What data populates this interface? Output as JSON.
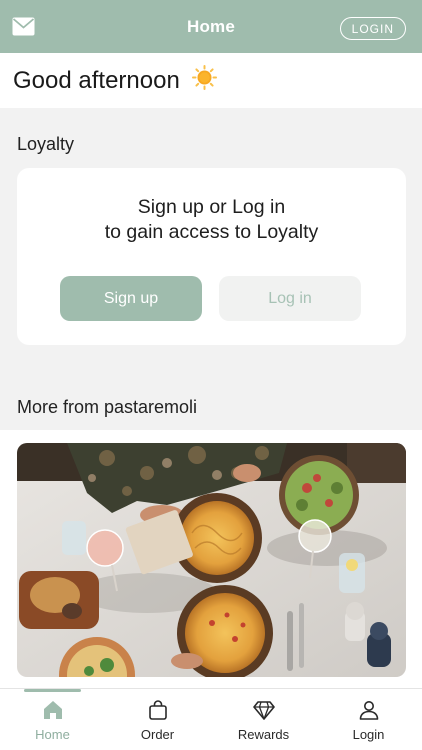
{
  "header": {
    "title": "Home",
    "login_label": "LOGIN",
    "mail_icon": "mail-icon"
  },
  "greeting": {
    "text": "Good afternoon",
    "icon": "sun-icon"
  },
  "loyalty": {
    "section_title": "Loyalty",
    "line1": "Sign up or Log in",
    "line2": "to gain access to Loyalty",
    "signup_label": "Sign up",
    "login_label": "Log in"
  },
  "more": {
    "section_title": "More from pastaremoli"
  },
  "tabs": [
    {
      "label": "Home",
      "icon": "home-icon",
      "active": true
    },
    {
      "label": "Order",
      "icon": "bag-icon",
      "active": false
    },
    {
      "label": "Rewards",
      "icon": "diamond-icon",
      "active": false
    },
    {
      "label": "Login",
      "icon": "person-icon",
      "active": false
    }
  ],
  "colors": {
    "accent": "#9fbcad",
    "active_tab": "#8fae9f"
  }
}
